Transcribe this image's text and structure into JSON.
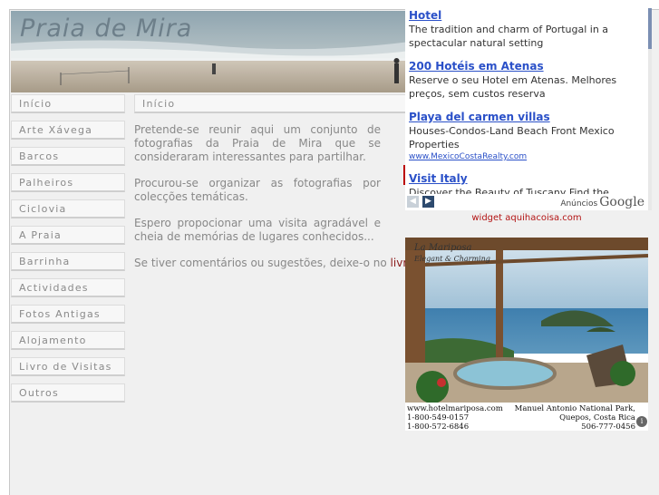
{
  "site": {
    "title": "Praia de Mira"
  },
  "menu": {
    "items": [
      {
        "label": "Início"
      },
      {
        "label": "Arte Xávega"
      },
      {
        "label": "Barcos"
      },
      {
        "label": "Palheiros"
      },
      {
        "label": "Ciclovia"
      },
      {
        "label": "A Praia"
      },
      {
        "label": "Barrinha"
      },
      {
        "label": "Actividades"
      },
      {
        "label": "Fotos Antigas"
      },
      {
        "label": "Alojamento"
      },
      {
        "label": "Livro de Visitas"
      },
      {
        "label": "Outros"
      }
    ]
  },
  "content": {
    "heading": "Início",
    "p1": "Pretende-se reunir aqui um conjunto de fotografias da Praia de Mira que se consideraram interessantes para partilhar.",
    "p2": "Procurou-se organizar as fotografias por colecções temáticas.",
    "p3": "Espero propocionar uma visita agradável e cheia de memórias de lugares conhecidos...",
    "p4_text": "Se tiver comentários ou sugestões, deixe-o no ",
    "p4_link": "livro de"
  },
  "ads": {
    "items": [
      {
        "title": "Hotel",
        "text": "The tradition and charm of Portugal in a spectacular natural setting",
        "url": ""
      },
      {
        "title": "200 Hotéis em Atenas",
        "text": "Reserve o seu Hotel em Atenas. Melhores preços, sem custos reserva",
        "url": ""
      },
      {
        "title": "Playa del carmen villas",
        "text": "Houses-Condos-Land Beach Front Mexico Properties",
        "url": "www.MexicoCostaRealty.com"
      },
      {
        "title": "Visit Italy",
        "text": "Discover the Beauty of Tuscany Find the Information Here!",
        "url": ""
      }
    ],
    "prev_icon": "◀",
    "next_icon": "▶",
    "label": "Anúncios",
    "brand": "Google"
  },
  "widget": {
    "text": "widget aquihacoisa.com"
  },
  "photo_ad": {
    "brand_name": "La Mariposa",
    "brand_tagline": "Elegant & Charming",
    "website": "www.hotelmariposa.com",
    "phone1": "1-800-549-0157",
    "phone2": "1-800-572-6846",
    "location1": "Manuel Antonio National Park,",
    "location2": "Quepos, Costa Rica",
    "phone3": "506-777-0456",
    "info_icon": "i"
  }
}
